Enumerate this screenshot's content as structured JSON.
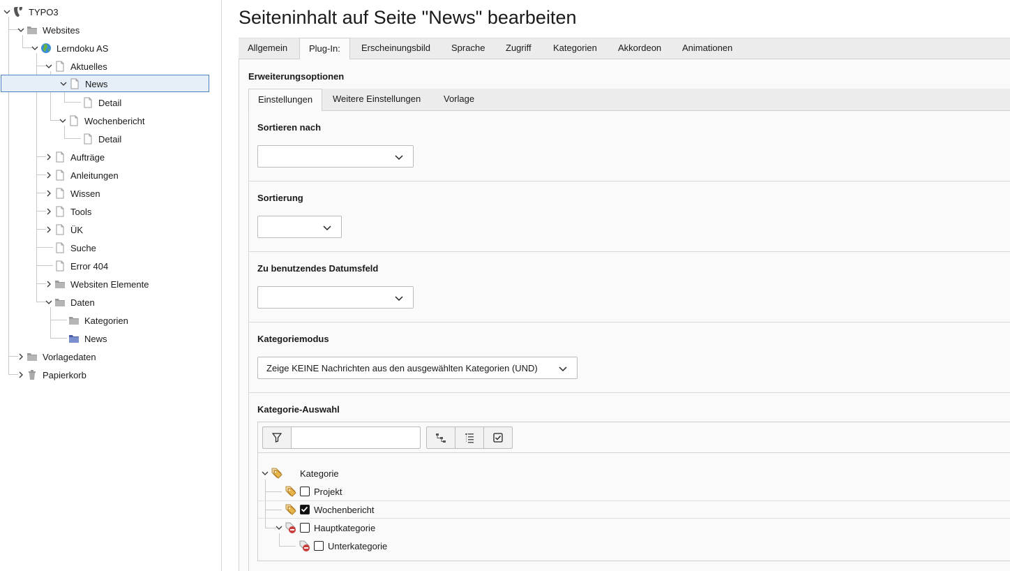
{
  "tree": {
    "nodes": [
      {
        "label": "TYPO3",
        "icon": "typo3-logo-icon",
        "expanded": true
      },
      {
        "label": "Websites",
        "icon": "folder-icon",
        "expanded": true
      },
      {
        "label": "Lerndoku AS",
        "icon": "globe-icon",
        "expanded": true
      },
      {
        "label": "Aktuelles",
        "icon": "page-icon",
        "expanded": true
      },
      {
        "label": "News",
        "icon": "page-icon",
        "expanded": true,
        "selected": true
      },
      {
        "label": "Detail",
        "icon": "page-icon"
      },
      {
        "label": "Wochenbericht",
        "icon": "page-icon",
        "expanded": true
      },
      {
        "label": "Detail",
        "icon": "page-icon"
      },
      {
        "label": "Aufträge",
        "icon": "page-icon",
        "expanded": false
      },
      {
        "label": "Anleitungen",
        "icon": "page-icon",
        "expanded": false
      },
      {
        "label": "Wissen",
        "icon": "page-icon",
        "expanded": false
      },
      {
        "label": "Tools",
        "icon": "page-icon",
        "expanded": false
      },
      {
        "label": "ÜK",
        "icon": "page-icon",
        "expanded": false
      },
      {
        "label": "Suche",
        "icon": "page-icon"
      },
      {
        "label": "Error 404",
        "icon": "page-icon"
      },
      {
        "label": "Websiten Elemente",
        "icon": "folder-icon",
        "expanded": false
      },
      {
        "label": "Daten",
        "icon": "folder-icon",
        "expanded": true
      },
      {
        "label": "Kategorien",
        "icon": "folder-icon"
      },
      {
        "label": "News",
        "icon": "folder-news-icon"
      },
      {
        "label": "Vorlagedaten",
        "icon": "folder-icon",
        "expanded": false
      },
      {
        "label": "Papierkorb",
        "icon": "trash-icon",
        "expanded": false
      }
    ]
  },
  "main": {
    "title": "Seiteninhalt auf Seite \"News\" bearbeiten",
    "tabs": [
      {
        "label": "Allgemein"
      },
      {
        "label": "Plug-In:",
        "active": true
      },
      {
        "label": "Erscheinungsbild"
      },
      {
        "label": "Sprache"
      },
      {
        "label": "Zugriff"
      },
      {
        "label": "Kategorien"
      },
      {
        "label": "Akkordeon"
      },
      {
        "label": "Animationen"
      }
    ],
    "extension_title": "Erweiterungsoptionen",
    "subtabs": [
      {
        "label": "Einstellungen",
        "active": true
      },
      {
        "label": "Weitere Einstellungen"
      },
      {
        "label": "Vorlage"
      }
    ],
    "fields": {
      "sort_by": {
        "label": "Sortieren nach",
        "value": ""
      },
      "sorting": {
        "label": "Sortierung",
        "value": ""
      },
      "date_field": {
        "label": "Zu benutzendes Datumsfeld",
        "value": ""
      },
      "category_mode": {
        "label": "Kategoriemodus",
        "value": "Zeige KEINE Nachrichten aus den ausgewählten Kategorien (UND)"
      },
      "category_selection": {
        "label": "Kategorie-Auswahl",
        "filter_value": ""
      }
    },
    "categories": [
      {
        "label": "Kategorie",
        "checked": null,
        "icon": "category-icon"
      },
      {
        "label": "Projekt",
        "checked": false,
        "icon": "category-icon"
      },
      {
        "label": "Wochenbericht",
        "checked": true,
        "icon": "category-icon"
      },
      {
        "label": "Hauptkategorie",
        "checked": false,
        "icon": "category-disabled-icon"
      },
      {
        "label": "Unterkategorie",
        "checked": false,
        "icon": "category-disabled-icon"
      }
    ]
  },
  "colors": {
    "selected_border": "#4f83c4",
    "selected_bg": "#e6eef8",
    "folder": "#9a9a9a",
    "news_folder": "#5a6fb5",
    "category_tag": "#e7b34b",
    "disabled_badge": "#c83c3c"
  }
}
